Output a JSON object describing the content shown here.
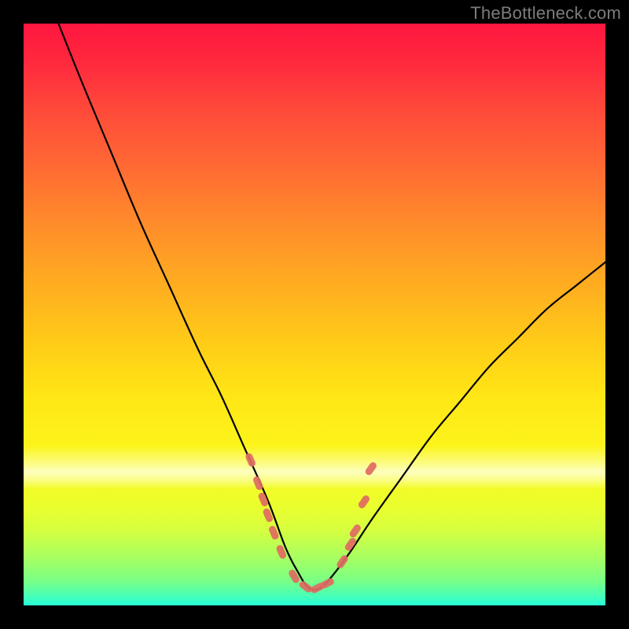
{
  "watermark": "TheBottleneck.com",
  "chart_data": {
    "type": "line",
    "title": "",
    "xlabel": "",
    "ylabel": "",
    "xlim": [
      0,
      100
    ],
    "ylim": [
      0,
      100
    ],
    "grid": false,
    "legend": "none",
    "notes": "V-shaped bottleneck curve on a vertical red→green gradient. Axes and units are not labeled in the image; x/y are normalized 0–100. y≈0 means optimal (green floor), y≈100 means worst (red top). Minimum of the curve is around x≈46–52 at y≈3. Salmon-colored capsule markers appear along the lower flanks of the curve clustered between roughly x≈38–44 on the left limb and x≈54–60 on the right limb, plus a few near the trough.",
    "series": [
      {
        "name": "curve",
        "x": [
          6,
          10,
          15,
          20,
          25,
          30,
          34,
          38,
          42,
          45,
          47,
          49,
          51,
          53,
          56,
          60,
          65,
          70,
          75,
          80,
          85,
          90,
          95,
          100
        ],
        "y": [
          100,
          90,
          78,
          66,
          55,
          44,
          36,
          27,
          18,
          10,
          6,
          3,
          3,
          5,
          9,
          15,
          22,
          29,
          35,
          41,
          46,
          51,
          55,
          59
        ]
      }
    ],
    "markers": [
      {
        "x": 39.0,
        "y": 25.0
      },
      {
        "x": 40.3,
        "y": 21.0
      },
      {
        "x": 41.2,
        "y": 18.2
      },
      {
        "x": 42.0,
        "y": 15.5
      },
      {
        "x": 43.0,
        "y": 12.5
      },
      {
        "x": 44.3,
        "y": 9.2
      },
      {
        "x": 46.5,
        "y": 5.0
      },
      {
        "x": 48.5,
        "y": 3.2
      },
      {
        "x": 50.5,
        "y": 3.0
      },
      {
        "x": 52.2,
        "y": 3.8
      },
      {
        "x": 54.8,
        "y": 7.5
      },
      {
        "x": 56.2,
        "y": 10.5
      },
      {
        "x": 57.0,
        "y": 12.8
      },
      {
        "x": 58.5,
        "y": 17.8
      },
      {
        "x": 59.7,
        "y": 23.5
      }
    ],
    "gradient_stops": [
      {
        "pct": 0,
        "color": "#ff163f"
      },
      {
        "pct": 25,
        "color": "#ff6b33"
      },
      {
        "pct": 56,
        "color": "#ffcf17"
      },
      {
        "pct": 78,
        "color": "#f6fb22"
      },
      {
        "pct": 93,
        "color": "#9aff6b"
      },
      {
        "pct": 100,
        "color": "#25ffd8"
      }
    ]
  }
}
